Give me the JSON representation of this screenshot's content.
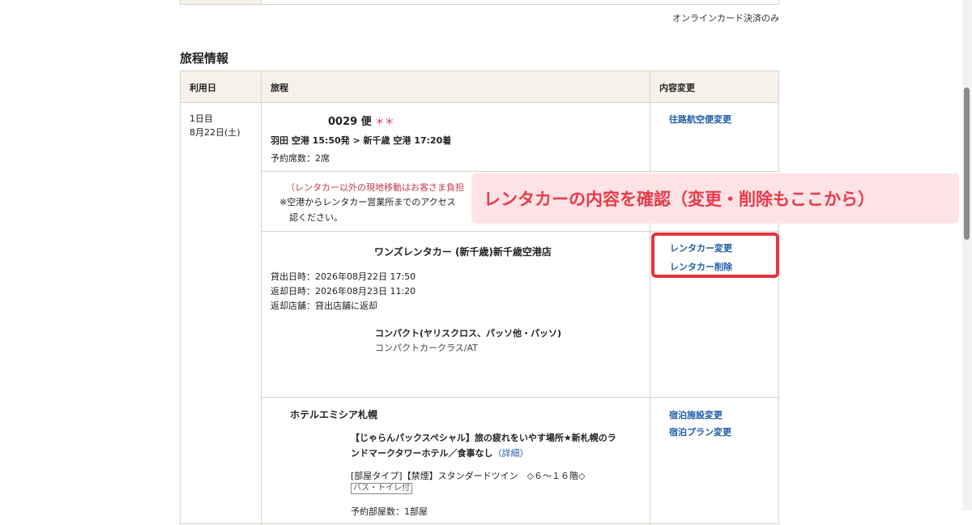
{
  "payment_note": "オンラインカード決済のみ",
  "section_title": "旅程情報",
  "table": {
    "headers": {
      "date": "利用日",
      "itinerary": "旅程",
      "change": "内容変更"
    }
  },
  "day": {
    "label": "1日目",
    "date": "8月22日(土)"
  },
  "flight": {
    "number": "0029 便",
    "stars": "＊＊",
    "route": "羽田 空港  15:50発 > 新千歳 空港  17:20着",
    "seats": "予約席数：2席",
    "change_link": "往路航空便変更"
  },
  "notice": {
    "line1": "（レンタカー以外の現地移動はお客さま負担",
    "line2": "※空港からレンタカー営業所までのアクセス",
    "line3": "認ください。"
  },
  "rental_car": {
    "name": "ワンズレンタカー (新千歳)新千歳空港店",
    "pickup": "貸出日時：2026年08月22日 17:50",
    "return": "返却日時：2026年08月23日 11:20",
    "return_store": "返却店舗：貸出店舗に返却",
    "car_class": "コンパクト(ヤリスクロス、パッソ他・パッソ)",
    "car_class_sub": "コンパクトカークラス/AT",
    "change_link": "レンタカー変更",
    "delete_link": "レンタカー削除"
  },
  "hotel": {
    "name": "ホテルエミシア札幌",
    "plan_line1": "【じゃらんパックスペシャル】旅の疲れをいやす場所★新札幌のラ",
    "plan_line2": "ンドマークタワーホテル／食事なし",
    "detail_link": "（詳細）",
    "room_type": "[部屋タイプ]【禁煙】スタンダードツイン　◇６～１６階◇",
    "room_badge": "バス・トイレ付",
    "rooms": "予約部屋数：1部屋",
    "facility_change_link": "宿泊施設変更",
    "plan_change_link": "宿泊プラン変更"
  },
  "callout": "レンタカーの内容を確認（変更・削除もここから）",
  "colors": {
    "link": "#1f5ea8",
    "header_bg": "#f5f2ea",
    "callout_bg": "#fde3e5",
    "callout_text": "#e83a4a",
    "highlight_border": "#e8333f",
    "stars": "#c0384b"
  }
}
